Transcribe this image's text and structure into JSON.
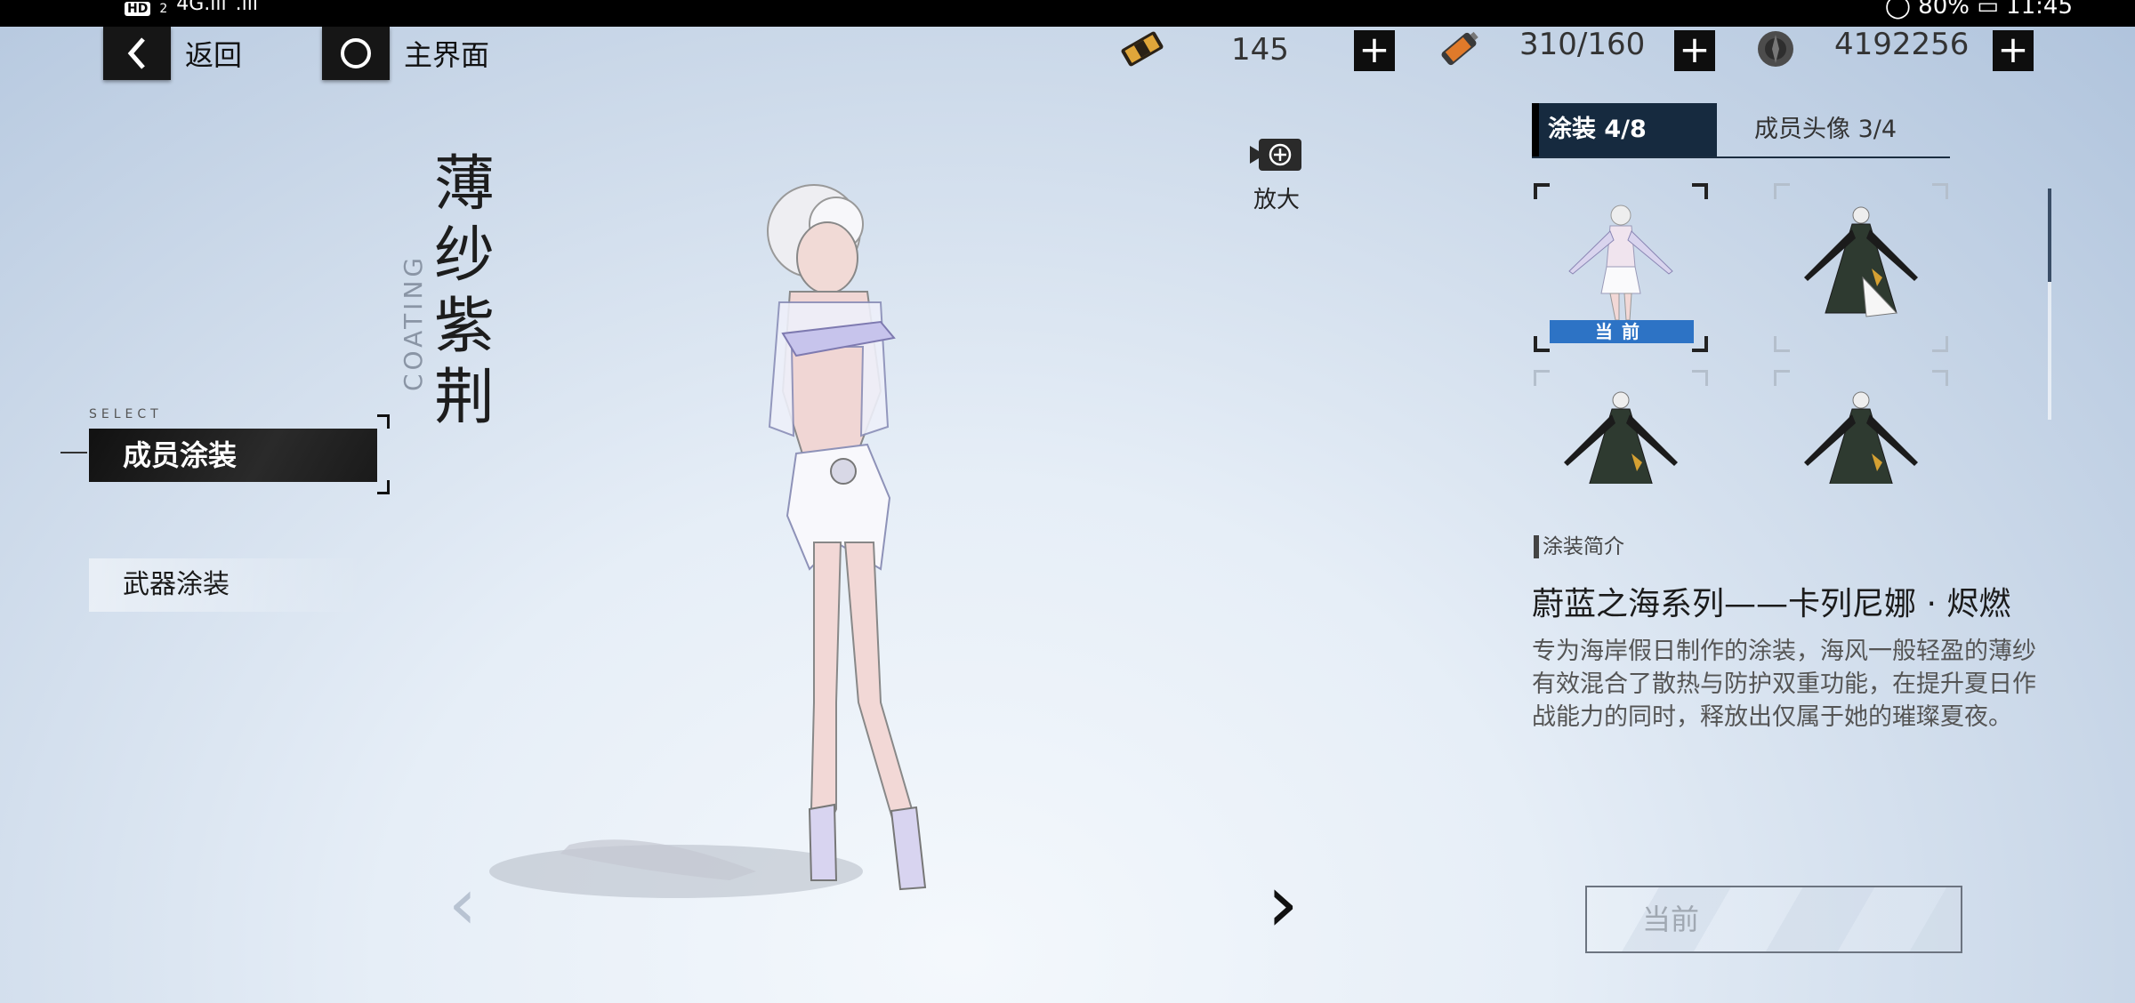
{
  "status_bar": {
    "hd_badge": "HD",
    "sim": "2",
    "signal1": "4G.ıll",
    "signal2": ".ıll",
    "right_text": "◯ 80% ▭ 11:45"
  },
  "nav": {
    "back_label": "返回",
    "home_label": "主界面"
  },
  "resources": [
    {
      "icon": "ticket-icon",
      "value": "145"
    },
    {
      "icon": "battery-icon",
      "value": "310/160"
    },
    {
      "icon": "coin-icon",
      "value": "4192256"
    }
  ],
  "character": {
    "name_chars": [
      "薄",
      "纱",
      "紫",
      "荆"
    ],
    "coating_label": "COATING"
  },
  "menu": {
    "select_tag": "SELECT",
    "member_coating": "成员涂装",
    "weapon_coating": "武器涂装"
  },
  "zoom": {
    "label": "放大"
  },
  "tabs": {
    "coating": "涂装 4/8",
    "avatar": "成员头像 3/4"
  },
  "thumbnails": {
    "current_tag": "当前"
  },
  "info": {
    "section_title": "涂装简介",
    "skin_name": "蔚蓝之海系列——卡列尼娜 · 烬燃",
    "description": "专为海岸假日制作的涂装，海风一般轻盈的薄纱有效混合了散热与防护双重功能，在提升夏日作战能力的同时，释放出仅属于她的璀璨夏夜。"
  },
  "action_button": {
    "label": "当前"
  },
  "colors": {
    "accent_blue": "#2d73c5",
    "tab_active_bg": "#162a3f",
    "dark": "#111111"
  }
}
